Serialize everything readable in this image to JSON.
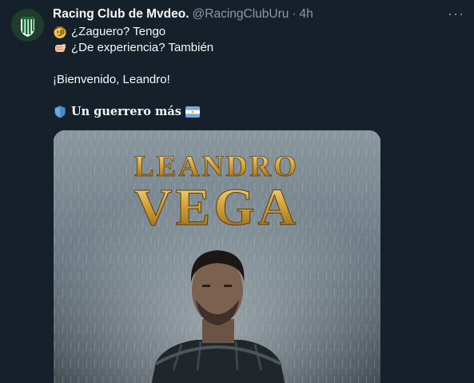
{
  "author": {
    "display_name": "Racing Club de Mvdeo.",
    "handle": "@RacingClubUru",
    "separator": "·",
    "time": "4h",
    "avatar_icon": "racing-club-crest"
  },
  "more_label": "···",
  "tweet": {
    "line1": "¿Zaguero? Tengo",
    "line1_icon": "face-with-monocle",
    "line2": "¿De experiencia? También",
    "line2_icon": "fist-bump",
    "line3": "¡Bienvenido, Leandro!",
    "line4": "Un guerrero más",
    "line4_icon": "shield",
    "line4_flag": "argentina-flag"
  },
  "media": {
    "title_top": "LEANDRO",
    "title_bottom": "VEGA"
  },
  "colors": {
    "background": "#15202b",
    "text": "#f7f9f9",
    "secondary": "#8b98a5",
    "gold": "#d4a437"
  }
}
